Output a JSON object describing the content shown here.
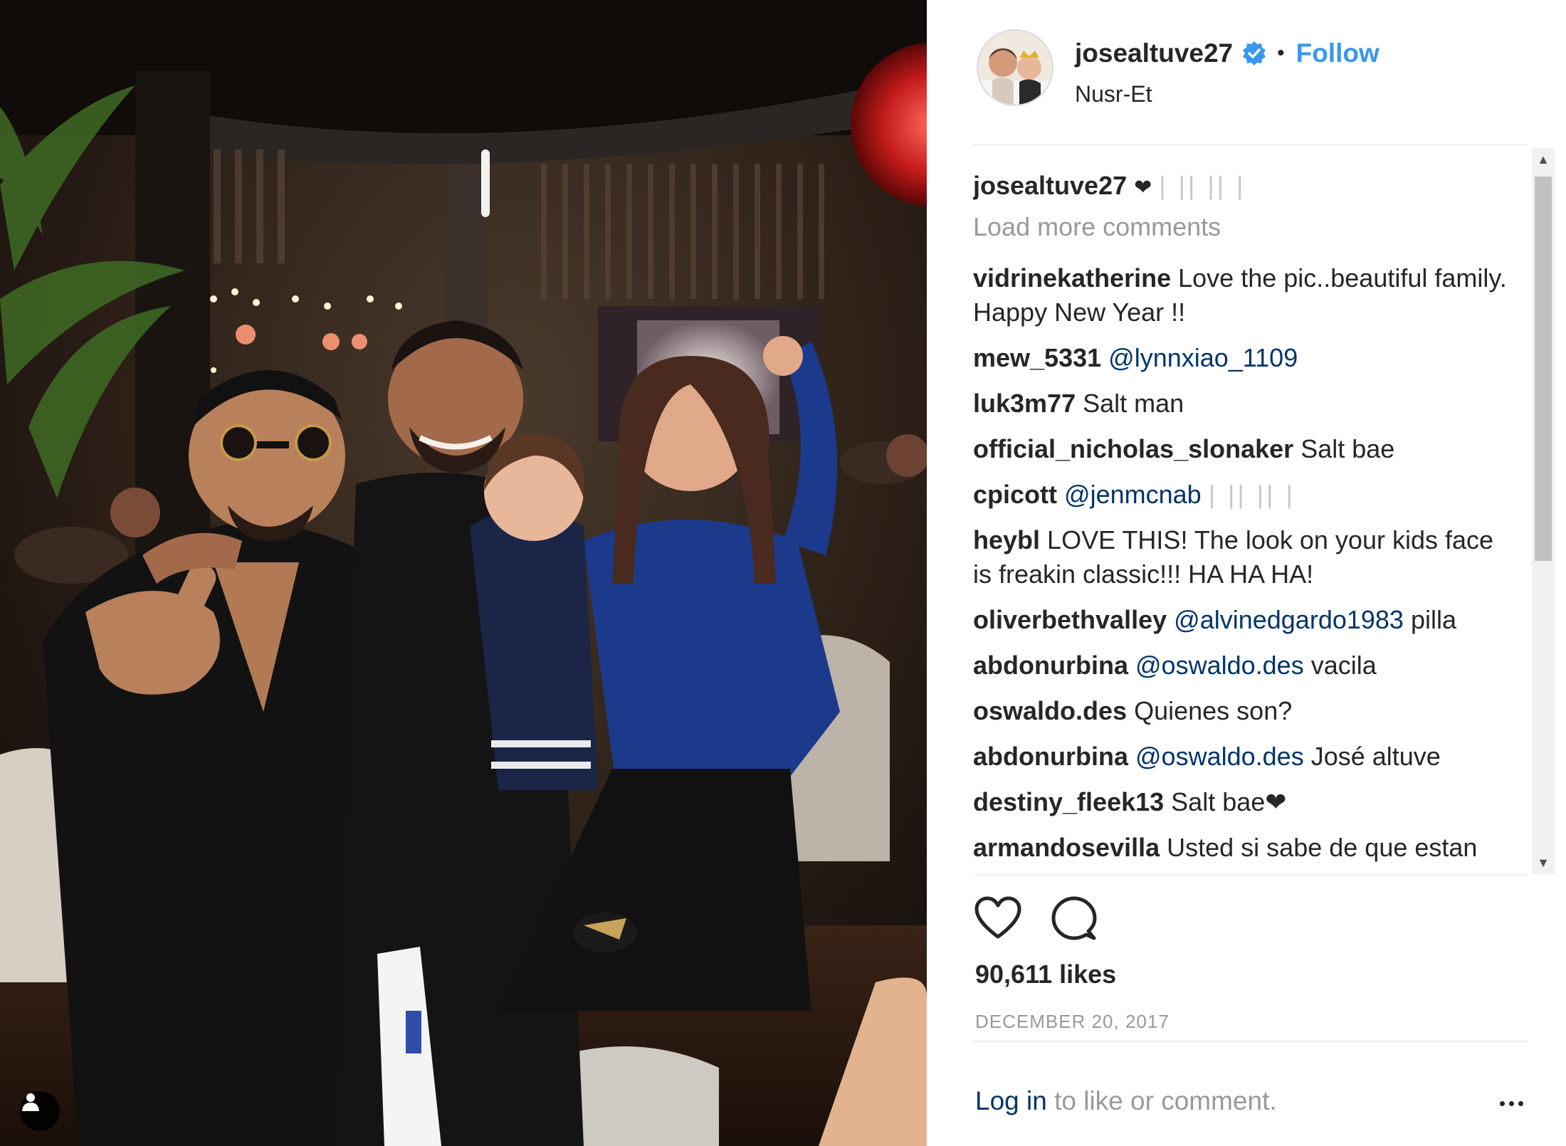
{
  "colors": {
    "accent": "#3897f0",
    "mention": "#003569",
    "muted": "#999999",
    "divider": "#efefef"
  },
  "photo": {
    "icons": {
      "user_tag": "person-icon"
    }
  },
  "header": {
    "username": "josealtuve27",
    "verified_icon": "verified-badge-icon",
    "separator": "•",
    "follow_label": "Follow",
    "location": "Nusr-Et"
  },
  "caption": {
    "username": "josealtuve27",
    "text": "❤",
    "faint": "| || || |"
  },
  "load_more": "Load more comments",
  "comments": [
    {
      "author": "vidrinekatherine",
      "text": "Love the pic..beautiful family. Happy New Year !!"
    },
    {
      "author": "mew_5331",
      "mention": "@lynnxiao_1109"
    },
    {
      "author": "luk3m77",
      "text": "Salt man"
    },
    {
      "author": "official_nicholas_slonaker",
      "text": "Salt bae"
    },
    {
      "author": "cpicott",
      "mention": "@jenmcnab",
      "faint": "| || || |"
    },
    {
      "author": "heybl",
      "text": "LOVE THIS! The look on your kids face is freakin classic!!! HA HA HA!"
    },
    {
      "author": "oliverbethvalley",
      "mention": "@alvinedgardo1983",
      "text": "pilla"
    },
    {
      "author": "abdonurbina",
      "mention": "@oswaldo.des",
      "text": "vacila"
    },
    {
      "author": "oswaldo.des",
      "text": "Quienes son?"
    },
    {
      "author": "abdonurbina",
      "mention": "@oswaldo.des",
      "text": "José altuve"
    },
    {
      "author": "destiny_fleek13",
      "text": "Salt bae❤"
    },
    {
      "author": "armandosevilla",
      "text": "Usted si sabe de que estan"
    }
  ],
  "actions": {
    "like_icon": "heart-outline-icon",
    "comment_icon": "speech-bubble-icon",
    "likes": "90,611 likes",
    "date": "DECEMBER 20, 2017"
  },
  "footer": {
    "login_link": "Log in",
    "login_rest": " to like or comment.",
    "more_icon": "more-options-icon"
  },
  "scrollbar": {
    "up_glyph": "▲",
    "down_glyph": "▼"
  }
}
